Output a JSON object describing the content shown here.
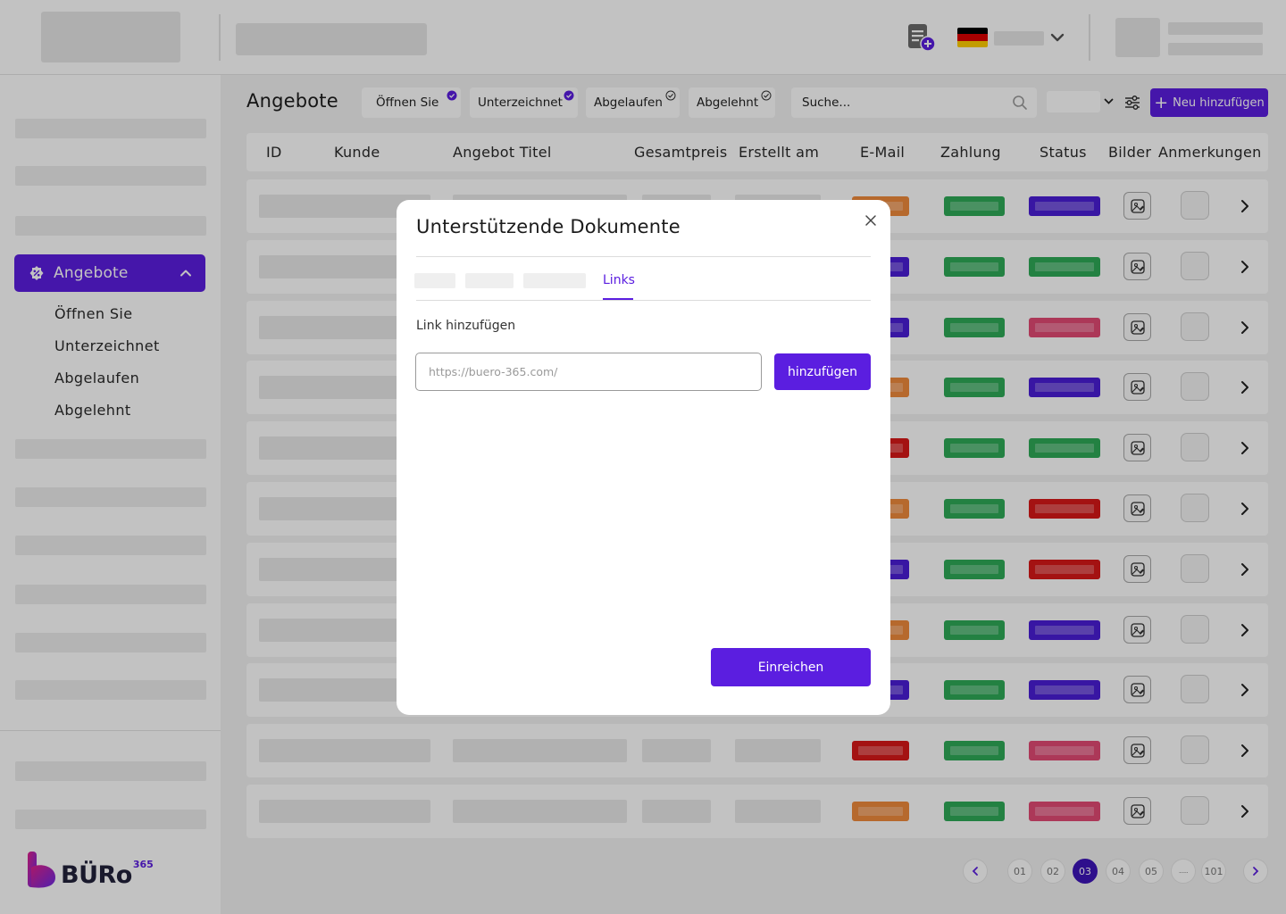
{
  "header": {
    "language_flag": "de-flag"
  },
  "sidebar": {
    "active_item": {
      "label": "Angebote",
      "icon": "discount-badge-icon"
    },
    "sub_items": [
      {
        "label": "Öffnen Sie"
      },
      {
        "label": "Unterzeichnet"
      },
      {
        "label": "Abgelaufen"
      },
      {
        "label": "Abgelehnt"
      }
    ],
    "brand": {
      "name": "BÜRo",
      "superscript": "365"
    }
  },
  "toolbar": {
    "page_title": "Angebote",
    "filters": [
      {
        "label": "Öffnen Sie",
        "checked": true
      },
      {
        "label": "Unterzeichnet",
        "checked": true
      },
      {
        "label": "Abgelaufen",
        "checked": false
      },
      {
        "label": "Abgelehnt",
        "checked": false
      }
    ],
    "search_placeholder": "Suche...",
    "new_button_label": "Neu hinzufügen"
  },
  "table": {
    "columns": [
      "ID",
      "Kunde",
      "Angebot Titel",
      "Gesamtpreis",
      "Erstellt am",
      "E-Mail",
      "Zahlung",
      "Status",
      "Bilder",
      "Anmerkungen"
    ],
    "rows": [
      {
        "email": "orange",
        "payment": "green",
        "status": "purple"
      },
      {
        "email": "purple",
        "payment": "green",
        "status": "green"
      },
      {
        "email": "purple",
        "payment": "green",
        "status": "pink"
      },
      {
        "email": "orange",
        "payment": "green",
        "status": "purple"
      },
      {
        "email": "red",
        "payment": "green",
        "status": "green"
      },
      {
        "email": "orange",
        "payment": "green",
        "status": "red"
      },
      {
        "email": "purple",
        "payment": "green",
        "status": "red"
      },
      {
        "email": "orange",
        "payment": "green",
        "status": "purple"
      },
      {
        "email": "purple",
        "payment": "green",
        "status": "purple"
      },
      {
        "email": "red",
        "payment": "green",
        "status": "pink"
      },
      {
        "email": "orange",
        "payment": "green",
        "status": "pink"
      }
    ]
  },
  "pagination": {
    "pages": [
      "01",
      "02",
      "03",
      "04",
      "05",
      "......",
      "101"
    ],
    "active": "03"
  },
  "modal": {
    "title": "Unterstützende Dokumente",
    "active_tab": "Links",
    "field_label": "Link hinzufügen",
    "input_placeholder": "https://buero-365.com/",
    "add_button": "hinzufügen",
    "submit_button": "Einreichen"
  },
  "colors": {
    "accent": "#5b1ee0",
    "orange": "#f08a3c",
    "green": "#2eaa57",
    "purple": "#4a1ed6",
    "pink": "#e34a74",
    "red": "#d81818"
  }
}
